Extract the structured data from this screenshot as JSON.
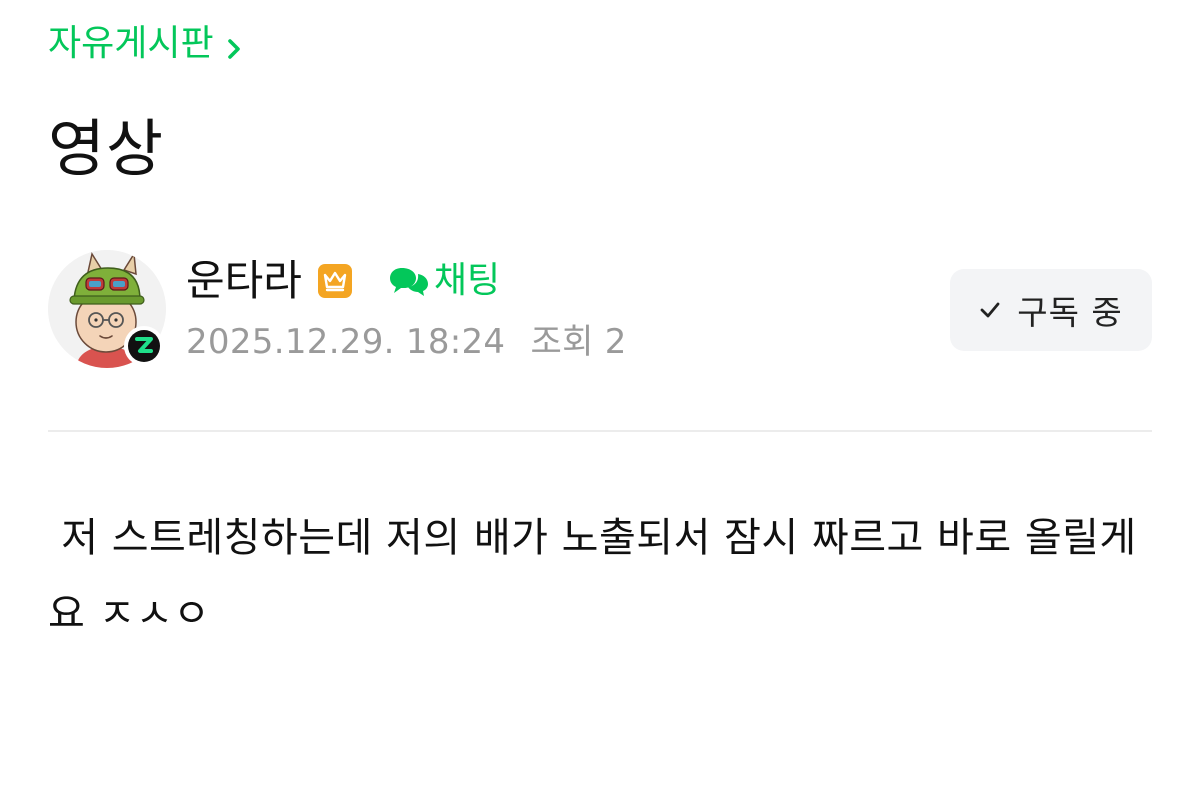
{
  "breadcrumb": {
    "board_name": "자유게시판",
    "chevron_icon": "chevron-right-icon"
  },
  "post": {
    "title": "영상",
    "body": " 저 스트레칭하는데 저의 배가 노출되서 잠시 짜르고 바로 올릴게요 ㅈㅅㅇ"
  },
  "author": {
    "nickname": "운타라",
    "badge_icon": "crown-icon",
    "chat_label": "채팅",
    "chat_icon": "chat-bubbles-icon",
    "date": "2025.12.29. 18:24",
    "views_label": "조회",
    "views_count": "2"
  },
  "subscribe": {
    "label": "구독 중",
    "icon": "checkmark-icon"
  },
  "colors": {
    "accent": "#03c75a",
    "badge": "#f4a522",
    "meta": "#9a9a9a",
    "button_bg": "#f3f4f6",
    "divider": "#ececec"
  }
}
